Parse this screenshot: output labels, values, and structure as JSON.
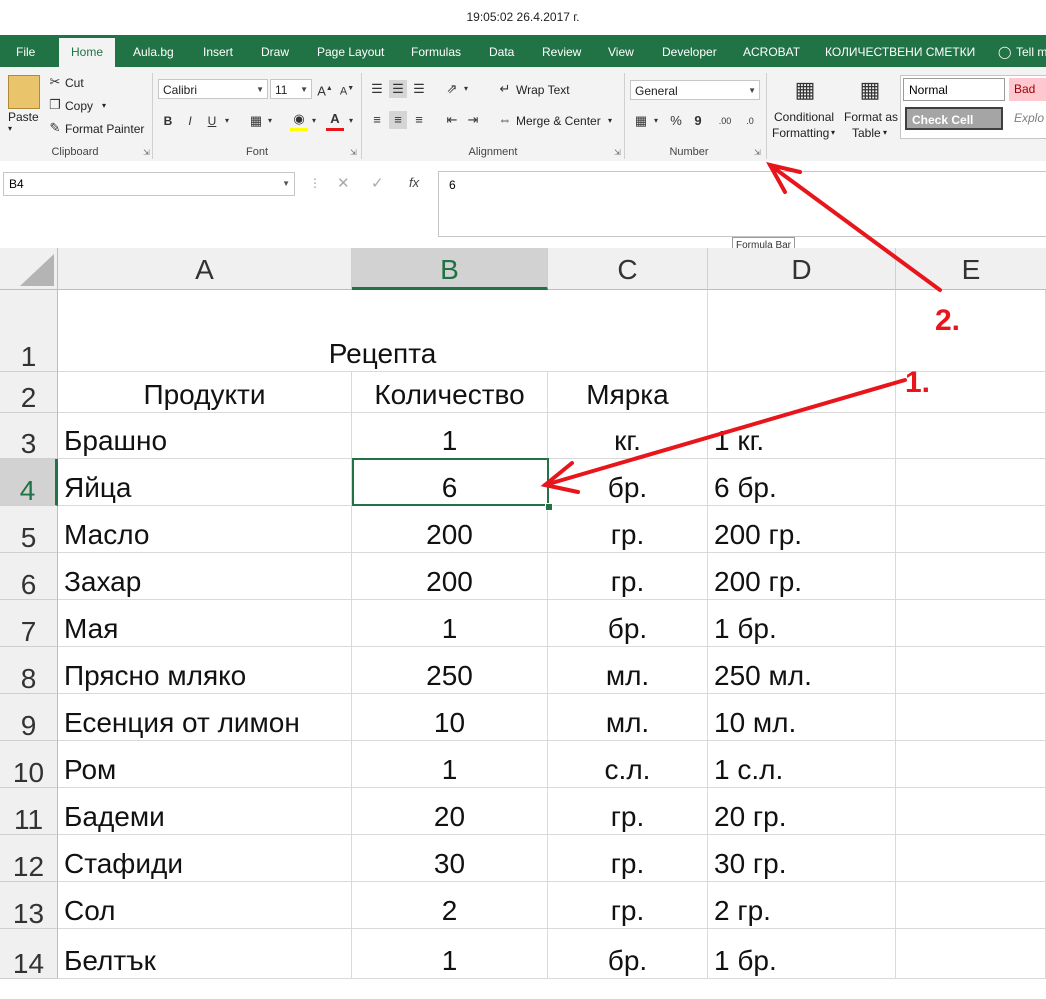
{
  "window": {
    "title": "19:05:02 26.4.2017 г."
  },
  "tabs": [
    "File",
    "Home",
    "Aula.bg",
    "Insert",
    "Draw",
    "Page Layout",
    "Formulas",
    "Data",
    "Review",
    "View",
    "Developer",
    "ACROBAT",
    "КОЛИЧЕСТВЕНИ СМЕТКИ",
    "Tell m"
  ],
  "ribbon": {
    "clipboard": {
      "paste": "Paste",
      "cut": "Cut",
      "copy": "Copy",
      "format_painter": "Format Painter",
      "label": "Clipboard"
    },
    "font": {
      "name": "Calibri",
      "size": "11",
      "bold": "B",
      "italic": "I",
      "underline": "U",
      "label": "Font"
    },
    "alignment": {
      "wrap_text": "Wrap Text",
      "merge_center": "Merge & Center",
      "label": "Alignment"
    },
    "number": {
      "format": "General",
      "percent": "%",
      "comma": "9",
      "label": "Number"
    },
    "styles": {
      "conditional_1": "Conditional",
      "conditional_2": "Formatting",
      "format_table_1": "Format as",
      "format_table_2": "Table",
      "normal": "Normal",
      "bad": "Bad",
      "check_cell": "Check Cell",
      "explanatory": "Explo"
    }
  },
  "formula_bar": {
    "name_box": "B4",
    "value": "6",
    "tooltip": "Formula Bar",
    "fx": "fx"
  },
  "sheet": {
    "columns": [
      "A",
      "B",
      "C",
      "D",
      "E"
    ],
    "selected_cell": "B4",
    "rows": [
      {
        "n": "1",
        "a": "Рецепта",
        "b": "",
        "c": "",
        "d": ""
      },
      {
        "n": "2",
        "a": "Продукти",
        "b": "Количество",
        "c": "Мярка",
        "d": ""
      },
      {
        "n": "3",
        "a": "Брашно",
        "b": "1",
        "c": "кг.",
        "d": "1 кг."
      },
      {
        "n": "4",
        "a": "Яйца",
        "b": "6",
        "c": "бр.",
        "d": "6 бр."
      },
      {
        "n": "5",
        "a": "Масло",
        "b": "200",
        "c": "гр.",
        "d": "200 гр."
      },
      {
        "n": "6",
        "a": "Захар",
        "b": "200",
        "c": "гр.",
        "d": "200 гр."
      },
      {
        "n": "7",
        "a": "Мая",
        "b": "1",
        "c": "бр.",
        "d": "1 бр."
      },
      {
        "n": "8",
        "a": "Прясно мляко",
        "b": "250",
        "c": "мл.",
        "d": "250 мл."
      },
      {
        "n": "9",
        "a": "Есенция от лимон",
        "b": "10",
        "c": "мл.",
        "d": "10 мл."
      },
      {
        "n": "10",
        "a": "Ром",
        "b": "1",
        "c": "с.л.",
        "d": "1 с.л."
      },
      {
        "n": "11",
        "a": "Бадеми",
        "b": "20",
        "c": "гр.",
        "d": "20 гр."
      },
      {
        "n": "12",
        "a": "Стафиди",
        "b": "30",
        "c": "гр.",
        "d": "30 гр."
      },
      {
        "n": "13",
        "a": "Сол",
        "b": "2",
        "c": "гр.",
        "d": "2 гр."
      },
      {
        "n": "14",
        "a": "Белтък",
        "b": "1",
        "c": "бр.",
        "d": "1 бр."
      }
    ]
  },
  "annotations": {
    "arrow_1": "1.",
    "arrow_2": "2."
  },
  "colors": {
    "excel_green": "#217346",
    "arrow_red": "#e8151b"
  }
}
